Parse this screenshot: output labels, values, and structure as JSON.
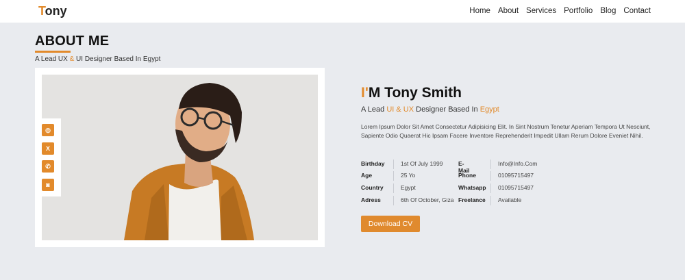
{
  "brand": {
    "first_letter": "T",
    "rest": "ony",
    "accent_color": "#e28a2b"
  },
  "nav": {
    "items": [
      {
        "label": "Home"
      },
      {
        "label": "About"
      },
      {
        "label": "Services"
      },
      {
        "label": "Portfolio"
      },
      {
        "label": "Blog"
      },
      {
        "label": "Contact"
      }
    ]
  },
  "about": {
    "title": "ABOUT ME",
    "subtitle": {
      "part1": "A Lead UX ",
      "amp": "&",
      "part2": " UI Designer Based In Egypt"
    }
  },
  "social": {
    "icons": [
      {
        "name": "dribbble-icon",
        "glyph": "◎"
      },
      {
        "name": "x-twitter-icon",
        "glyph": "X"
      },
      {
        "name": "whatsapp-icon",
        "glyph": "✆"
      },
      {
        "name": "instagram-icon",
        "glyph": "◙"
      }
    ]
  },
  "profile": {
    "heading_accent": "I",
    "heading_apostrophe": "'",
    "heading_rest": "M Tony Smith",
    "role": {
      "p1": "A Lead ",
      "a1": "UI & UX",
      "p2": " Designer Based In ",
      "a2": "Egypt"
    },
    "bio": "Lorem Ipsum Dolor Sit Amet Consectetur Adipisicing Elit. In Sint Nostrum Tenetur Aperiam Tempora Ut Nesciunt, Sapiente Odio Quaerat Hic Ipsam Facere Inventore Reprehenderit Impedit Ullam Rerum Dolore Eveniet Nihil.",
    "info_left": [
      {
        "label": "Birthday",
        "value": "1st Of July 1999"
      },
      {
        "label": "Age",
        "value": "25 Yo"
      },
      {
        "label": "Country",
        "value": "Egypt"
      },
      {
        "label": "Adress",
        "value": "6th Of October, Giza"
      }
    ],
    "info_right": [
      {
        "label": "E-Mail",
        "value": "Info@Info.Com"
      },
      {
        "label": "Phone",
        "value": "01095715497"
      },
      {
        "label": "Whatsapp",
        "value": "01095715497"
      },
      {
        "label": "Freelance",
        "value": "Available"
      }
    ],
    "cv_button": "Download CV"
  }
}
